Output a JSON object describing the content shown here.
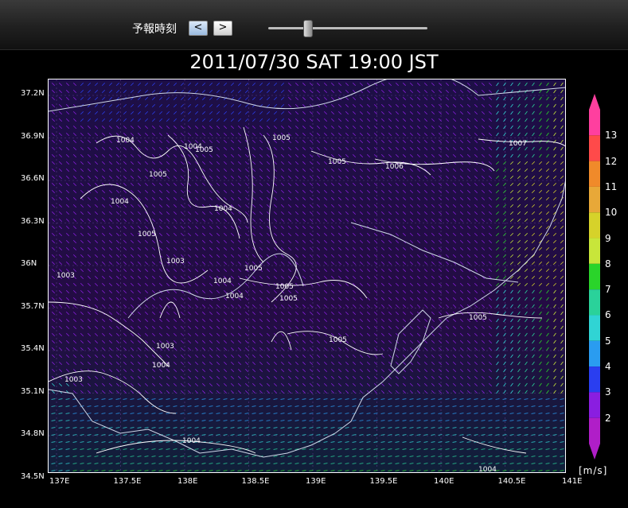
{
  "controls": {
    "label": "予報時刻",
    "prev_label": "<",
    "next_label": ">",
    "slider_value": 0.23
  },
  "title": "2011/07/30 SAT 19:00 JST",
  "axes": {
    "lat_ticks": [
      "37.2N",
      "36.9N",
      "36.6N",
      "36.3N",
      "36N",
      "35.7N",
      "35.4N",
      "35.1N",
      "34.8N",
      "34.5N"
    ],
    "lon_ticks": [
      "137E",
      "137.5E",
      "138E",
      "138.5E",
      "139E",
      "139.5E",
      "140E",
      "140.5E",
      "141E"
    ]
  },
  "isobars": [
    {
      "label": "1004"
    },
    {
      "label": "1004"
    },
    {
      "label": "1005"
    },
    {
      "label": "1005"
    },
    {
      "label": "1006"
    },
    {
      "label": "1007"
    },
    {
      "label": "1005"
    },
    {
      "label": "1004"
    },
    {
      "label": "1004"
    },
    {
      "label": "1003"
    },
    {
      "label": "1003"
    },
    {
      "label": "1005"
    },
    {
      "label": "1004"
    },
    {
      "label": "1005"
    },
    {
      "label": "1005"
    },
    {
      "label": "1004"
    },
    {
      "label": "1005"
    },
    {
      "label": "1005"
    },
    {
      "label": "1003"
    },
    {
      "label": "1004"
    },
    {
      "label": "1003"
    },
    {
      "label": "1004"
    },
    {
      "label": "1004"
    },
    {
      "label": "1005"
    },
    {
      "label": "1005"
    }
  ],
  "legend": {
    "unit": "[m/s]",
    "levels": [
      "13",
      "12",
      "11",
      "10",
      "9",
      "8",
      "7",
      "6",
      "5",
      "4",
      "3",
      "2"
    ],
    "colors": [
      "#ff3f9f",
      "#ff4a4a",
      "#f08a2a",
      "#e8a838",
      "#d6d22a",
      "#c8e63a",
      "#2ad42a",
      "#2ad29a",
      "#30d4d4",
      "#2a9cf0",
      "#2a3ef0",
      "#8a1ee0",
      "#b01ec8"
    ],
    "arrow_top_color": "#ff3f9f",
    "arrow_bottom_color": "#b01ec8"
  }
}
